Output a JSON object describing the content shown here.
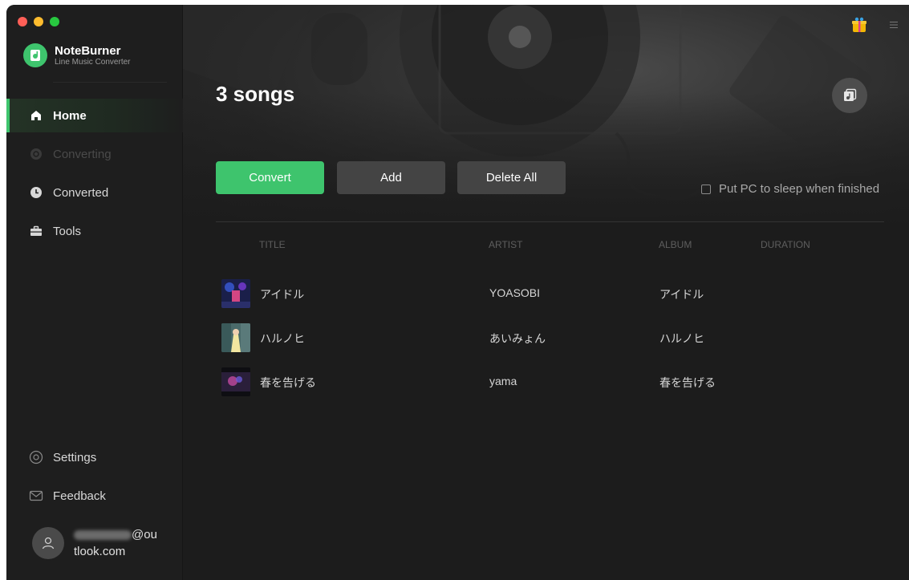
{
  "app": {
    "name": "NoteBurner",
    "subtitle": "Line Music Converter"
  },
  "sidebar": {
    "items": [
      {
        "label": "Home",
        "icon": "home-icon",
        "state": "active"
      },
      {
        "label": "Converting",
        "icon": "converting-icon",
        "state": "disabled"
      },
      {
        "label": "Converted",
        "icon": "clock-icon",
        "state": "normal"
      },
      {
        "label": "Tools",
        "icon": "toolbox-icon",
        "state": "normal"
      }
    ],
    "bottom": [
      {
        "label": "Settings",
        "icon": "gear-icon"
      },
      {
        "label": "Feedback",
        "icon": "mail-icon"
      }
    ],
    "user": {
      "email_line1_suffix": "@ou",
      "email_line2": "tlook.com"
    }
  },
  "main": {
    "title": "3 songs",
    "buttons": {
      "convert": "Convert",
      "add": "Add",
      "delete_all": "Delete All"
    },
    "sleep_label": "Put PC to sleep when finished",
    "columns": {
      "title": "TITLE",
      "artist": "ARTIST",
      "album": "ALBUM",
      "duration": "DURATION"
    },
    "songs": [
      {
        "title": "アイドル",
        "artist": "YOASOBI",
        "album": "アイドル",
        "duration": ""
      },
      {
        "title": "ハルノヒ",
        "artist": "あいみょん",
        "album": "ハルノヒ",
        "duration": ""
      },
      {
        "title": "春を告げる",
        "artist": "yama",
        "album": "春を告げる",
        "duration": ""
      }
    ]
  },
  "colors": {
    "accent": "#3ec46d",
    "sidebar_bg": "#1e1e1e",
    "main_bg": "#1c1c1c",
    "button_gray": "#444444"
  }
}
